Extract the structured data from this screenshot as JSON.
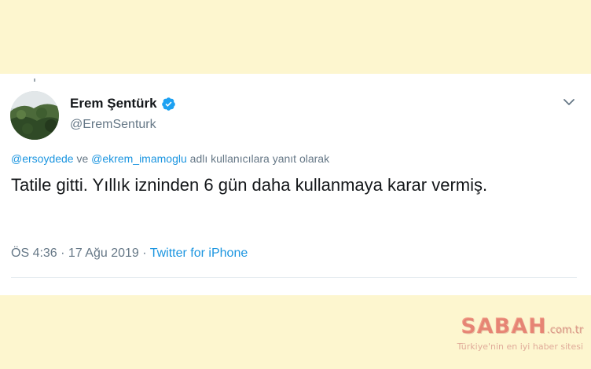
{
  "tweet": {
    "author": {
      "name": "Erem Şentürk",
      "handle": "@EremSenturk",
      "verified": true
    },
    "reply_context": {
      "mention_1": "@ersoydede",
      "conjunction": " ve ",
      "mention_2": "@ekrem_imamoglu",
      "suffix": " adlı kullanıcılara yanıt olarak"
    },
    "text": "Tatile gitti. Yıllık izninden 6 gün daha kullanmaya karar vermiş.",
    "time": "ÖS 4:36",
    "separator": " · ",
    "date": "17 Ağu 2019",
    "source": "Twitter for iPhone"
  },
  "watermark": {
    "logo": "SABAH",
    "tld": ".com.tr",
    "slogan": "Türkiye'nin en iyi haber sitesi"
  },
  "colors": {
    "accent": "#1b95e0",
    "background_band": "#fdf6cf",
    "muted_text": "#657786"
  },
  "icons": {
    "verified": "verified-badge-icon",
    "more": "chevron-down-icon"
  }
}
